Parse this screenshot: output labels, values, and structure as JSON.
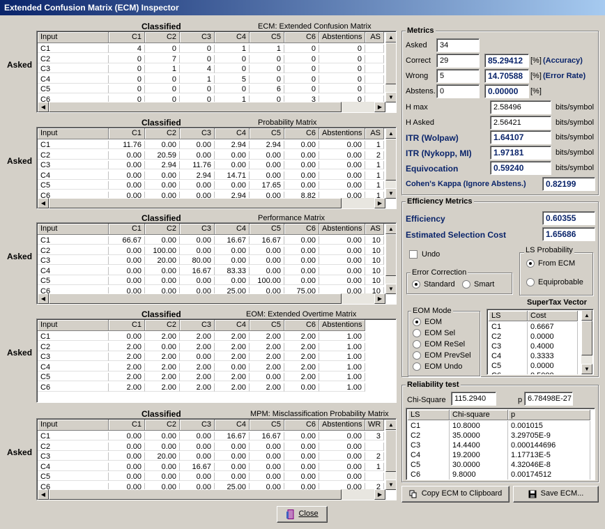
{
  "window": {
    "title": "Extended Confusion Matrix (ECM) Inspector"
  },
  "common": {
    "asked_label": "Asked",
    "classified_label": "Classified"
  },
  "matrices": [
    {
      "title": "ECM: Extended Confusion Matrix",
      "headers": [
        "Input",
        "C1",
        "C2",
        "C3",
        "C4",
        "C5",
        "C6",
        "Abstentions",
        "AS"
      ],
      "rows": [
        [
          "C1",
          "4",
          "0",
          "0",
          "1",
          "1",
          "0",
          "0",
          ""
        ],
        [
          "C2",
          "0",
          "7",
          "0",
          "0",
          "0",
          "0",
          "0",
          ""
        ],
        [
          "C3",
          "0",
          "1",
          "4",
          "0",
          "0",
          "0",
          "0",
          ""
        ],
        [
          "C4",
          "0",
          "0",
          "1",
          "5",
          "0",
          "0",
          "0",
          ""
        ],
        [
          "C5",
          "0",
          "0",
          "0",
          "0",
          "6",
          "0",
          "0",
          ""
        ],
        [
          "C6",
          "0",
          "0",
          "0",
          "1",
          "0",
          "3",
          "0",
          ""
        ]
      ]
    },
    {
      "title": "Probability Matrix",
      "headers": [
        "Input",
        "C1",
        "C2",
        "C3",
        "C4",
        "C5",
        "C6",
        "Abstentions",
        "AS"
      ],
      "rows": [
        [
          "C1",
          "11.76",
          "0.00",
          "0.00",
          "2.94",
          "2.94",
          "0.00",
          "0.00",
          "1"
        ],
        [
          "C2",
          "0.00",
          "20.59",
          "0.00",
          "0.00",
          "0.00",
          "0.00",
          "0.00",
          "2"
        ],
        [
          "C3",
          "0.00",
          "2.94",
          "11.76",
          "0.00",
          "0.00",
          "0.00",
          "0.00",
          "1"
        ],
        [
          "C4",
          "0.00",
          "0.00",
          "2.94",
          "14.71",
          "0.00",
          "0.00",
          "0.00",
          "1"
        ],
        [
          "C5",
          "0.00",
          "0.00",
          "0.00",
          "0.00",
          "17.65",
          "0.00",
          "0.00",
          "1"
        ],
        [
          "C6",
          "0.00",
          "0.00",
          "0.00",
          "2.94",
          "0.00",
          "8.82",
          "0.00",
          "1"
        ]
      ]
    },
    {
      "title": "Performance Matrix",
      "headers": [
        "Input",
        "C1",
        "C2",
        "C3",
        "C4",
        "C5",
        "C6",
        "Abstentions",
        "AS"
      ],
      "rows": [
        [
          "C1",
          "66.67",
          "0.00",
          "0.00",
          "16.67",
          "16.67",
          "0.00",
          "0.00",
          "10"
        ],
        [
          "C2",
          "0.00",
          "100.00",
          "0.00",
          "0.00",
          "0.00",
          "0.00",
          "0.00",
          "10"
        ],
        [
          "C3",
          "0.00",
          "20.00",
          "80.00",
          "0.00",
          "0.00",
          "0.00",
          "0.00",
          "10"
        ],
        [
          "C4",
          "0.00",
          "0.00",
          "16.67",
          "83.33",
          "0.00",
          "0.00",
          "0.00",
          "10"
        ],
        [
          "C5",
          "0.00",
          "0.00",
          "0.00",
          "0.00",
          "100.00",
          "0.00",
          "0.00",
          "10"
        ],
        [
          "C6",
          "0.00",
          "0.00",
          "0.00",
          "25.00",
          "0.00",
          "75.00",
          "0.00",
          "10"
        ]
      ]
    },
    {
      "title": "EOM: Extended Overtime Matrix",
      "headers": [
        "Input",
        "C1",
        "C2",
        "C3",
        "C4",
        "C5",
        "C6",
        "Abstentions"
      ],
      "rows": [
        [
          "C1",
          "0.00",
          "2.00",
          "2.00",
          "2.00",
          "2.00",
          "2.00",
          "1.00"
        ],
        [
          "C2",
          "2.00",
          "0.00",
          "2.00",
          "2.00",
          "2.00",
          "2.00",
          "1.00"
        ],
        [
          "C3",
          "2.00",
          "2.00",
          "0.00",
          "2.00",
          "2.00",
          "2.00",
          "1.00"
        ],
        [
          "C4",
          "2.00",
          "2.00",
          "2.00",
          "0.00",
          "2.00",
          "2.00",
          "1.00"
        ],
        [
          "C5",
          "2.00",
          "2.00",
          "2.00",
          "2.00",
          "0.00",
          "2.00",
          "1.00"
        ],
        [
          "C6",
          "2.00",
          "2.00",
          "2.00",
          "2.00",
          "2.00",
          "0.00",
          "1.00"
        ]
      ]
    },
    {
      "title": "MPM: Misclassification Probability Matrix",
      "headers": [
        "Input",
        "C1",
        "C2",
        "C3",
        "C4",
        "C5",
        "C6",
        "Abstentions",
        "WR"
      ],
      "rows": [
        [
          "C1",
          "0.00",
          "0.00",
          "0.00",
          "16.67",
          "16.67",
          "0.00",
          "0.00",
          "3"
        ],
        [
          "C2",
          "0.00",
          "0.00",
          "0.00",
          "0.00",
          "0.00",
          "0.00",
          "0.00",
          ""
        ],
        [
          "C3",
          "0.00",
          "20.00",
          "0.00",
          "0.00",
          "0.00",
          "0.00",
          "0.00",
          "2"
        ],
        [
          "C4",
          "0.00",
          "0.00",
          "16.67",
          "0.00",
          "0.00",
          "0.00",
          "0.00",
          "1"
        ],
        [
          "C5",
          "0.00",
          "0.00",
          "0.00",
          "0.00",
          "0.00",
          "0.00",
          "0.00",
          ""
        ],
        [
          "C6",
          "0.00",
          "0.00",
          "0.00",
          "25.00",
          "0.00",
          "0.00",
          "0.00",
          "2"
        ]
      ]
    }
  ],
  "metrics": {
    "title": "Metrics",
    "asked_label": "Asked",
    "asked": "34",
    "correct_label": "Correct",
    "correct": "29",
    "accuracy": "85.29412",
    "accuracy_unit": "[%]",
    "accuracy_label": "(Accuracy)",
    "wrong_label": "Wrong",
    "wrong": "5",
    "error_rate": "14.70588",
    "error_unit": "[%]",
    "error_label": "(Error Rate)",
    "abstens_label": "Abstens.",
    "abstens": "0",
    "abstens_pct": "0.00000",
    "abstens_unit": "[%]",
    "hmax_label": "H max",
    "hmax": "2.58496",
    "hasked_label": "H Asked",
    "hasked": "2.56421",
    "itr_wolpaw_label": "ITR (Wolpaw)",
    "itr_wolpaw": "1.64107",
    "itr_nykopp_label": "ITR (Nykopp, MI)",
    "itr_nykopp": "1.97181",
    "equivocation_label": "Equivocation",
    "equivocation": "0.59240",
    "bits_unit": "bits/symbol",
    "kappa_label": "Cohen's Kappa (Ignore Abstens.)",
    "kappa": "0.82199"
  },
  "efficiency": {
    "title": "Efficiency Metrics",
    "efficiency_label": "Efficiency",
    "efficiency": "0.60355",
    "esc_label": "Estimated Selection Cost",
    "esc": "1.65686",
    "undo_label": "Undo",
    "ls_prob_title": "LS Probability",
    "from_ecm": "From ECM",
    "equiprobable": "Equiprobable",
    "error_correction_title": "Error Correction",
    "standard": "Standard",
    "smart": "Smart",
    "eom_mode_title": "EOM Mode",
    "eom_modes": [
      "EOM",
      "EOM Sel",
      "EOM ReSel",
      "EOM PrevSel",
      "EOM Undo"
    ],
    "supertax_title": "SuperTax Vector",
    "supertax_headers": [
      "LS",
      "Cost"
    ],
    "supertax_rows": [
      [
        "C1",
        "0.6667"
      ],
      [
        "C2",
        "0.0000"
      ],
      [
        "C3",
        "0.4000"
      ],
      [
        "C4",
        "0.3333"
      ],
      [
        "C5",
        "0.0000"
      ],
      [
        "C6",
        "0.5000"
      ]
    ]
  },
  "reliability": {
    "title": "Reliability test",
    "chi_label": "Chi-Square",
    "chi": "115.2940",
    "p_label": "p",
    "p": "6.78498E-27",
    "headers": [
      "LS",
      "Chi-square",
      "p"
    ],
    "rows": [
      [
        "C1",
        "10.8000",
        "0.001015"
      ],
      [
        "C2",
        "35.0000",
        "3.29705E-9"
      ],
      [
        "C3",
        "14.4400",
        "0.000144696"
      ],
      [
        "C4",
        "19.2000",
        "1.17713E-5"
      ],
      [
        "C5",
        "30.0000",
        "4.32046E-8"
      ],
      [
        "C6",
        "9.8000",
        "0.00174512"
      ]
    ]
  },
  "buttons": {
    "copy": "Copy ECM to Clipboard",
    "save": "Save ECM...",
    "close": "Close"
  }
}
